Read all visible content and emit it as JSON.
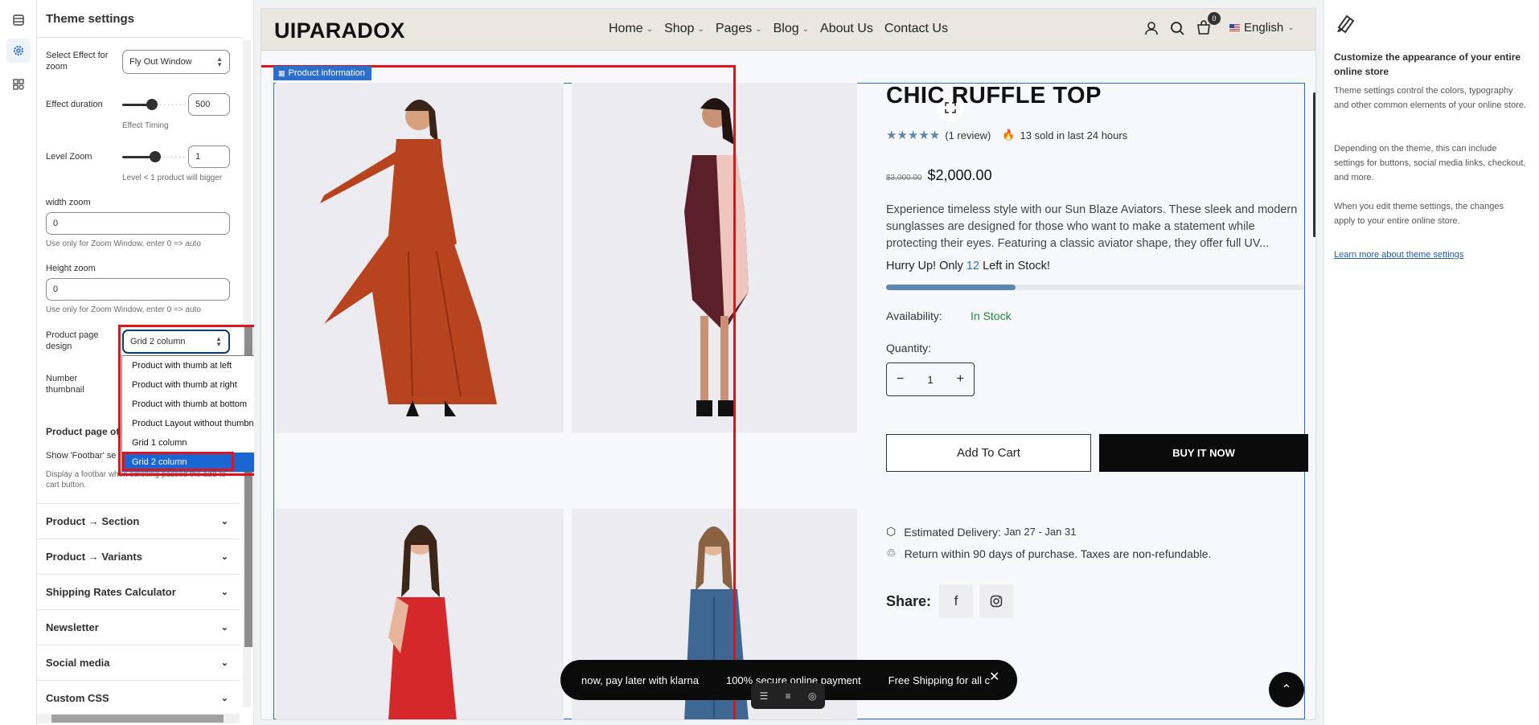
{
  "panel": {
    "title": "Theme settings",
    "zoom_effect": {
      "label": "Select Effect for zoom",
      "value": "Fly Out Window"
    },
    "effect_duration": {
      "label": "Effect duration",
      "value": "500",
      "help": "Effect Timing"
    },
    "level_zoom": {
      "label": "Level Zoom",
      "value": "1",
      "help": "Level < 1 product will bigger"
    },
    "width_zoom": {
      "label": "width zoom",
      "value": "0",
      "help": "Use only for Zoom Window, enter 0 => auto"
    },
    "height_zoom": {
      "label": "Height zoom",
      "value": "0",
      "help": "Use only for Zoom Window, enter 0 => auto"
    },
    "page_design": {
      "label": "Product page design",
      "value": "Grid 2 column"
    },
    "number_thumbnail": {
      "label": "Number thumbnail"
    },
    "page_other": {
      "label": "Product page ot"
    },
    "footbar": {
      "label": "Show 'Footbar' se",
      "help": "Display a footbar when scrolling passed the add-to-cart button."
    },
    "sections": [
      "Product → Section",
      "Product → Variants",
      "Shipping Rates Calculator",
      "Newsletter",
      "Social media",
      "Custom CSS"
    ]
  },
  "dropdown": {
    "options": [
      "Product with thumb at left",
      "Product with thumb at right",
      "Product with thumb at bottom",
      "Product Layout without thumbnail",
      "Grid 1 column",
      "Grid 2 column"
    ],
    "selected": "Grid 2 column"
  },
  "store": {
    "logo": "UIPARADOX",
    "nav": [
      {
        "label": "Home",
        "dropdown": true
      },
      {
        "label": "Shop",
        "dropdown": true
      },
      {
        "label": "Pages",
        "dropdown": true
      },
      {
        "label": "Blog",
        "dropdown": true
      },
      {
        "label": "About Us",
        "dropdown": false
      },
      {
        "label": "Contact Us",
        "dropdown": false
      }
    ],
    "cart_count": "0",
    "language": "English"
  },
  "section_tag": "Product information",
  "product": {
    "title": "CHIC RUFFLE TOP",
    "reviews": "(1 review)",
    "sold": "13 sold in last 24 hours",
    "old_price": "$3,000.00",
    "price": "$2,000.00",
    "description": "Experience timeless style with our Sun Blaze Aviators. These sleek and modern sunglasses are designed for those who want to make a statement while protecting their eyes. Featuring a classic aviator shape, they offer full UV...",
    "hurry_prefix": "Hurry Up! Only ",
    "stock_left": "12",
    "hurry_suffix": " Left in Stock!",
    "stock_fill_percent": 31,
    "availability_label": "Availability:",
    "availability_value": "In Stock",
    "quantity_label": "Quantity:",
    "quantity": "1",
    "add_to_cart": "Add To Cart",
    "buy_now": "BUY IT NOW",
    "delivery_label": "Estimated Delivery:",
    "delivery_value": "Jan 27 - Jan 31",
    "returns": "Return within 90 days of purchase. Taxes are non-refundable.",
    "share_label": "Share:"
  },
  "promo": [
    "now, pay later with klarna",
    "100% secure online payment",
    "Free Shipping for all c"
  ],
  "help": {
    "title": "Customize the appearance of your entire online store",
    "p1": "Theme settings control the colors, typography and other common elements of your online store.",
    "p2": "Depending on the theme, this can include settings for buttons, social media links, checkout, and more.",
    "p3": "When you edit theme settings, the changes apply to your entire online store.",
    "link": "Learn more about theme settings"
  },
  "colors": {
    "accent": "#2c6ecb",
    "annotation_red": "#e0141b",
    "in_stock": "#1f8a37"
  }
}
